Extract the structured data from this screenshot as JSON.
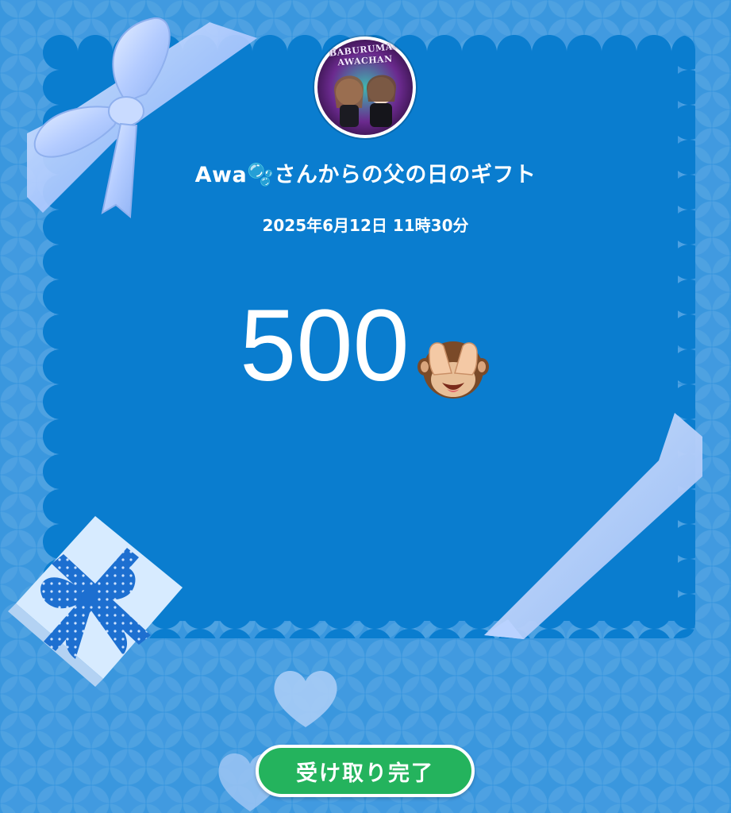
{
  "gift": {
    "avatar_text_line1": "BABURUMAN",
    "avatar_text_line2": "AWACHAN",
    "sender_title": "Awa🫧さんからの父の日のギフト",
    "date": "2025年6月12日 11時30分",
    "amount": "500",
    "amount_emoji_icon": "see-no-evil-monkey-icon",
    "received_button_label": "受け取り完了"
  },
  "colors": {
    "background": "#2b8fdc",
    "card": "#0a7dcf",
    "ribbon": "#b9d2ff",
    "button": "#24b35d",
    "text": "#ffffff"
  }
}
